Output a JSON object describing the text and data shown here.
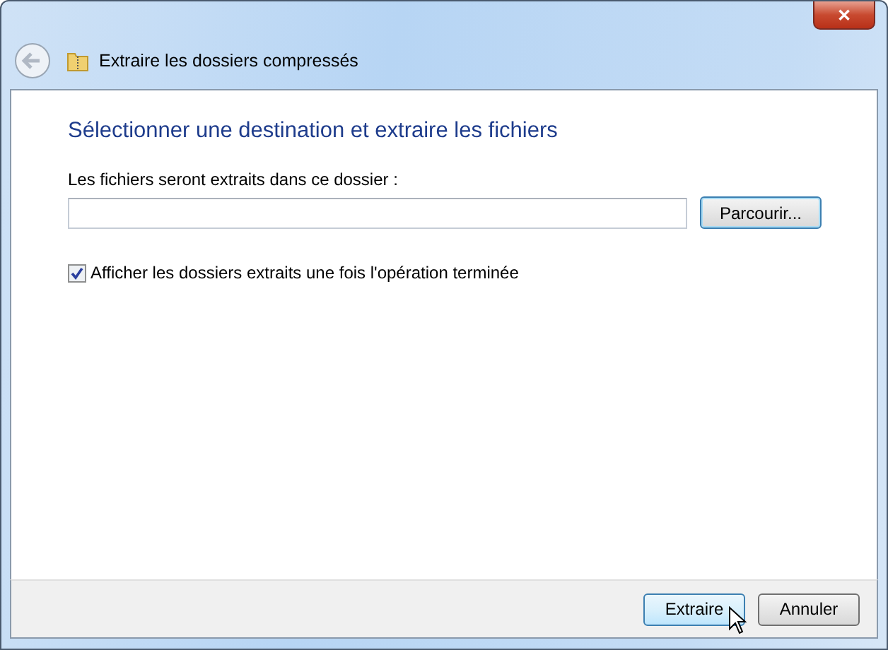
{
  "window": {
    "title": "Extraire les dossiers compressés",
    "close": "✕"
  },
  "heading": "Sélectionner une destination et extraire les fichiers",
  "destination": {
    "label": "Les fichiers seront extraits dans ce dossier :",
    "browse": "Parcourir..."
  },
  "option": {
    "label": "Afficher les dossiers extraits une fois l'opération terminée",
    "checked": true
  },
  "buttons": [
    {
      "label": "Extraire",
      "kind": "default"
    },
    {
      "label": "Annuler",
      "kind": "normal"
    }
  ]
}
